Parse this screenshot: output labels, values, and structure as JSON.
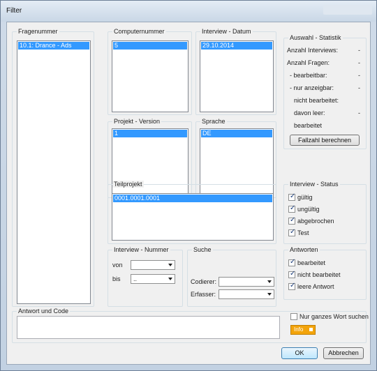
{
  "window": {
    "title": "Filter"
  },
  "fragenummer": {
    "legend": "Fragenummer",
    "items": [
      "10.1: Drance - Ads"
    ]
  },
  "computernummer": {
    "legend": "Computernummer",
    "items": [
      "5"
    ]
  },
  "interview_datum": {
    "legend": "Interview - Datum",
    "items": [
      "29.10.2014"
    ]
  },
  "projekt_version": {
    "legend": "Projekt - Version",
    "items": [
      "1"
    ]
  },
  "sprache": {
    "legend": "Sprache",
    "items": [
      "DE"
    ]
  },
  "teilprojekt": {
    "legend": "Teilprojekt",
    "items": [
      "0001.0001.0001"
    ]
  },
  "statistik": {
    "legend": "Auswahl - Statistik",
    "rows": [
      {
        "label": "Anzahl Interviews:",
        "value": "-"
      },
      {
        "label": "Anzahl Fragen:",
        "value": "-"
      },
      {
        "label": "- bearbeitbar:",
        "value": "-"
      },
      {
        "label": "- nur anzeigbar:",
        "value": "-"
      },
      {
        "label": "nicht bearbeitet:",
        "value": ""
      },
      {
        "label": "davon leer:",
        "value": "-"
      },
      {
        "label": "bearbeitet",
        "value": ""
      }
    ],
    "button": "Fallzahl berechnen"
  },
  "status": {
    "legend": "Interview - Status",
    "items": [
      {
        "label": "gültig",
        "checked": true
      },
      {
        "label": "ungültig",
        "checked": true
      },
      {
        "label": "abgebrochen",
        "checked": true
      },
      {
        "label": "Test",
        "checked": true
      }
    ]
  },
  "antworten": {
    "legend": "Antworten",
    "items": [
      {
        "label": "bearbeitet",
        "checked": true
      },
      {
        "label": "nicht bearbeitet",
        "checked": true
      },
      {
        "label": "leere Antwort",
        "checked": true
      }
    ]
  },
  "interview_nummer": {
    "legend": "Interview - Nummer",
    "von_label": "von",
    "bis_label": "bis",
    "von_value": "",
    "bis_value": ".."
  },
  "suche": {
    "legend": "Suche",
    "codierer_label": "Codierer:",
    "erfasser_label": "Erfasser:",
    "codierer_value": "",
    "erfasser_value": ""
  },
  "antwort_code": {
    "legend": "Antwort und Code",
    "whole_word_label": "Nur ganzes Wort suchen",
    "whole_word_checked": false,
    "info_label": "Info"
  },
  "buttons": {
    "ok": "OK",
    "cancel": "Abbrechen"
  },
  "colors": {
    "selection": "#3399ff",
    "info": "#f3a40b"
  }
}
